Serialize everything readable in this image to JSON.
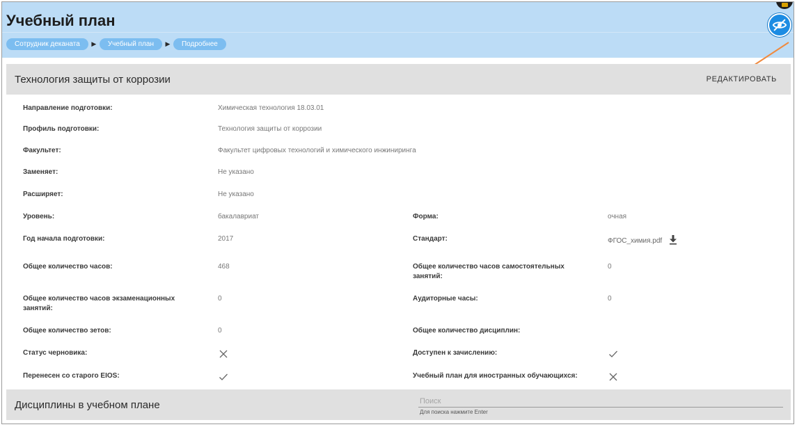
{
  "header": {
    "title": "Учебный план",
    "breadcrumbs": [
      "Сотрудник деканата",
      "Учебный план",
      "Подробнее"
    ]
  },
  "plan": {
    "title": "Технология защиты от коррозии",
    "edit_label": "РЕДАКТИРОВАТЬ"
  },
  "fields": {
    "direction": {
      "label": "Направление подготовки:",
      "value": "Химическая технология 18.03.01"
    },
    "profile": {
      "label": "Профиль подготовки:",
      "value": "Технология защиты от коррозии"
    },
    "faculty": {
      "label": "Факультет:",
      "value": "Факультет цифровых технологий и химического инжиниринга"
    },
    "replaces": {
      "label": "Заменяет:",
      "value": "Не указано"
    },
    "extends": {
      "label": "Расширяет:",
      "value": "Не указано"
    },
    "level": {
      "label": "Уровень:",
      "value": "бакалавриат"
    },
    "form": {
      "label": "Форма:",
      "value": "очная"
    },
    "start_year": {
      "label": "Год начала подготовки:",
      "value": "2017"
    },
    "standard": {
      "label": "Стандарт:",
      "value": "ФГОС_химия.pdf"
    },
    "total_hours": {
      "label": "Общее количество часов:",
      "value": "468"
    },
    "self_study_hours": {
      "label": "Общее количество часов самостоятельных занятий:",
      "value": "0"
    },
    "exam_hours": {
      "label": "Общее количество часов экзаменационных занятий:",
      "value": "0"
    },
    "classroom_hours": {
      "label": "Аудиторные часы:",
      "value": "0"
    },
    "zet_count": {
      "label": "Общее количество зетов:",
      "value": "0"
    },
    "discipline_count": {
      "label": "Общее количество дисциплин:",
      "value": ""
    },
    "draft_status": {
      "label": "Статус черновика:",
      "state": "no"
    },
    "available_for_enrollment": {
      "label": "Доступен к зачислению:",
      "state": "yes"
    },
    "migrated_from_old_eios": {
      "label": "Перенесен со старого EIOS:",
      "state": "yes"
    },
    "for_foreign_students": {
      "label": "Учебный план для иностранных обучающихся:",
      "state": "no"
    }
  },
  "disciplines": {
    "title": "Дисциплины в учебном плане",
    "search_placeholder": "Поиск",
    "search_hint": "Для поиска нажмите Enter"
  },
  "colors": {
    "topbar": "#bcdcf6",
    "crumb": "#7cbdf0",
    "accent": "#1c8ce3",
    "annotation_arrow": "#f08a3e",
    "section_header": "#e0e0e0"
  },
  "icons": {
    "visibility_toggle": "eye-off-icon",
    "chat": "chat-icon",
    "download": "download-icon",
    "no": "close-icon",
    "yes": "check-icon"
  }
}
